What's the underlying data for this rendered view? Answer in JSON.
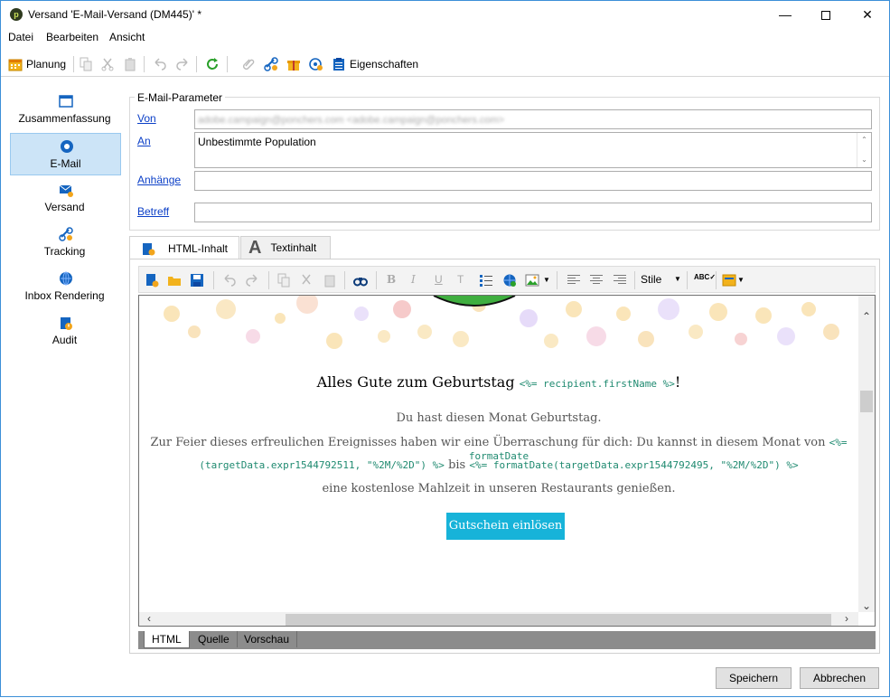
{
  "window": {
    "title": "Versand 'E-Mail-Versand (DM445)' *",
    "app_icon_glyph": "p",
    "minimize_glyph": "—",
    "close_glyph": "✕"
  },
  "menu": [
    "Datei",
    "Bearbeiten",
    "Ansicht"
  ],
  "toolbar": {
    "planning_label": "Planung",
    "properties_label": "Eigenschaften"
  },
  "nav": {
    "items": [
      {
        "label": "Zusammenfassung",
        "icon": "summary-icon"
      },
      {
        "label": "E-Mail",
        "icon": "email-icon",
        "active": true
      },
      {
        "label": "Versand",
        "icon": "delivery-icon"
      },
      {
        "label": "Tracking",
        "icon": "tracking-icon"
      },
      {
        "label": "Inbox Rendering",
        "icon": "inbox-rendering-icon"
      },
      {
        "label": "Audit",
        "icon": "audit-icon"
      }
    ]
  },
  "params": {
    "group_title": "E-Mail-Parameter",
    "from_label": "Von",
    "from_value": "adobe.campaign@ponchers.com <adobe.campaign@ponchers.com>",
    "to_label": "An",
    "to_value": "Unbestimmte Population",
    "attachments_label": "Anhänge",
    "attachments_value": "",
    "subject_label": "Betreff",
    "subject_value": ""
  },
  "tabs": {
    "html_label": "HTML-Inhalt",
    "text_label": "Textinhalt"
  },
  "editor": {
    "style_select": "Stile",
    "headline_text": "Alles Gute zum Geburtstag",
    "headline_tpl": "<%= recipient.firstName %>",
    "headline_end": "!",
    "line1": "Du hast diesen Monat Geburtstag.",
    "line2_text": "Zur Feier dieses erfreulichen Ereignisses haben wir eine Überraschung für dich: Du kannst in diesem Monat von",
    "line2_tpl": "<%= formatDate",
    "line3_tpl_a": "(targetData.expr1544792511, \"%2M/%2D\") %>",
    "line3_mid": "bis",
    "line3_tpl_b": "<%= formatDate(targetData.expr1544792495, \"%2M/%2D\") %>",
    "line4": "eine kostenlose Mahlzeit in unseren Restaurants genießen.",
    "cta_label": "Gutschein einlösen",
    "cta_color": "#17b3d9"
  },
  "view_tabs": [
    "HTML",
    "Quelle",
    "Vorschau"
  ],
  "footer": {
    "save_label": "Speichern",
    "cancel_label": "Abbrechen"
  },
  "colors": {
    "link": "#0b3fc7",
    "nav_active_bg": "#cce4f7",
    "template_code": "#1f8a70"
  }
}
